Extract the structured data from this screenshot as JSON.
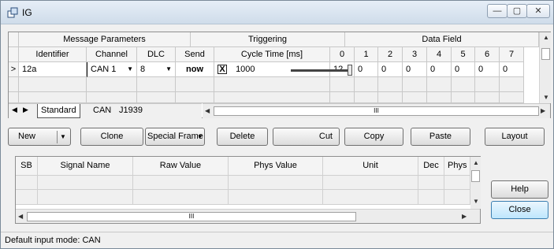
{
  "window": {
    "title": "IG",
    "min_glyph": "—",
    "max_glyph": "▢",
    "close_glyph": "✕"
  },
  "message_grid": {
    "group_headers": [
      "Message Parameters",
      "Triggering",
      "Data Field"
    ],
    "columns": [
      "Identifier",
      "Channel",
      "DLC",
      "Send",
      "Cycle Time [ms]",
      "0",
      "1",
      "2",
      "3",
      "4",
      "5",
      "6",
      "7"
    ],
    "row": {
      "marker": ">",
      "identifier": "12a",
      "channel": "CAN 1",
      "dlc": "8",
      "send": "now",
      "cyclic_checked": "X",
      "cycle_time": "1000",
      "slider_level": 1.0,
      "data": [
        "12",
        "0",
        "0",
        "0",
        "0",
        "0",
        "0",
        "0"
      ]
    }
  },
  "tabs": [
    "Standard",
    "CAN",
    "J1939"
  ],
  "scroll_glyph": "III",
  "buttons": {
    "new": "New",
    "new_arrow": "▼",
    "clone": "Clone",
    "special_frame": "Special Frame",
    "special_arrow": "▾",
    "delete": "Delete",
    "cut": "Cut",
    "copy": "Copy",
    "paste": "Paste",
    "layout": "Layout",
    "help": "Help",
    "close": "Close"
  },
  "signal_grid": {
    "columns": [
      "SB",
      "Signal Name",
      "Raw Value",
      "Phys Value",
      "Unit",
      "Dec",
      "Phys"
    ]
  },
  "status": "Default input mode: CAN"
}
